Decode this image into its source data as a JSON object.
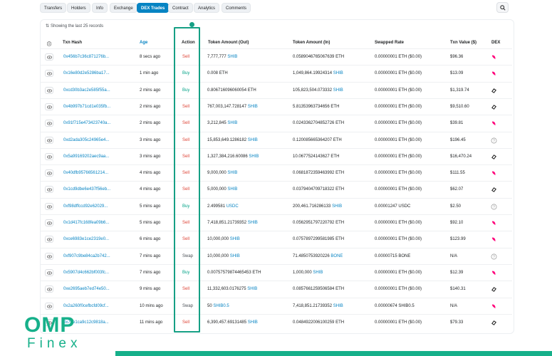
{
  "tabs": [
    {
      "label": "Transfers"
    },
    {
      "label": "Holders"
    },
    {
      "label": "Info"
    },
    {
      "label": "Exchange"
    },
    {
      "label": "DEX Trades",
      "active": true
    },
    {
      "label": "Contract"
    },
    {
      "label": "Analytics"
    },
    {
      "label": "Comments"
    }
  ],
  "search_icon": "search-icon",
  "summary": "Showing the last 25 records",
  "columns": {
    "hash": "Txn Hash",
    "age": "Age",
    "action": "Action",
    "out": "Token Amount (Out)",
    "in": "Token Amount (In)",
    "rate": "Swapped Rate",
    "value": "Txn Value ($)",
    "dex": "DEX"
  },
  "colors": {
    "accent": "#0784c3",
    "sell": "#de4437",
    "buy": "#00a186",
    "brand": "#16b08a"
  },
  "rows": [
    {
      "hash": "0x456b7c36c871276b...",
      "age": "8 secs ago",
      "action": "Sell",
      "out_amt": "7,777,777",
      "out_tok": "SHIB",
      "in_amt": "0.0589046765067639",
      "in_tok": "ETH",
      "rate": "0.00000001 ETH ($0.00)",
      "value": "$96.36",
      "dex": "uniswap-icon"
    },
    {
      "hash": "0x16e80d2e5286ba17...",
      "age": "1 min ago",
      "action": "Buy",
      "out_amt": "0.008",
      "out_tok": "ETH",
      "in_amt": "1,049,864.19924314",
      "in_tok": "SHIB",
      "rate": "0.00000001 ETH ($0.00)",
      "value": "$13.09",
      "dex": "uniswap-icon"
    },
    {
      "hash": "0xcd30b3ac2e585f55a...",
      "age": "2 mins ago",
      "action": "Buy",
      "out_amt": "0.806716096060054",
      "out_tok": "ETH",
      "in_amt": "105,823,504.073332",
      "in_tok": "SHIB",
      "rate": "0.00000001 ETH ($0.00)",
      "value": "$1,319.74",
      "dex": "sushiswap-icon"
    },
    {
      "hash": "0x4b997b71cd1e035fb...",
      "age": "2 mins ago",
      "action": "Sell",
      "out_amt": "767,003,147.728147",
      "out_tok": "SHIB",
      "in_amt": "5.81353963734656",
      "in_tok": "ETH",
      "rate": "0.00000001 ETH ($0.00)",
      "value": "$9,510.60",
      "dex": "sushiswap-icon"
    },
    {
      "hash": "0x91f715e473423740a...",
      "age": "2 mins ago",
      "action": "Sell",
      "out_amt": "3,212,845",
      "out_tok": "SHIB",
      "in_amt": "0.0243362704852726",
      "in_tok": "ETH",
      "rate": "0.00000001 ETH ($0.00)",
      "value": "$39.81",
      "dex": "uniswap-icon"
    },
    {
      "hash": "0xd2ada305c24965e4...",
      "age": "3 mins ago",
      "action": "Sell",
      "out_amt": "15,853,649.1286182",
      "out_tok": "SHIB",
      "in_amt": "0.120085665364207",
      "in_tok": "ETH",
      "rate": "0.00000001 ETH ($0.00)",
      "value": "$196.45",
      "dex": "unknown-dex-icon"
    },
    {
      "hash": "0x5a99169202aec9aa...",
      "age": "3 mins ago",
      "action": "Sell",
      "out_amt": "1,327,384,216.60086",
      "out_tok": "SHIB",
      "in_amt": "10.0677524143627",
      "in_tok": "ETH",
      "rate": "0.00000001 ETH ($0.00)",
      "value": "$16,470.24",
      "dex": "sushiswap-icon"
    },
    {
      "hash": "0x40dfb95766561214...",
      "age": "4 mins ago",
      "action": "Sell",
      "out_amt": "9,000,000",
      "out_tok": "SHIB",
      "in_amt": "0.0681872359463992",
      "in_tok": "ETH",
      "rate": "0.00000001 ETH ($0.00)",
      "value": "$111.55",
      "dex": "uniswap-icon"
    },
    {
      "hash": "0x1cd9dbe6e437f56eb...",
      "age": "4 mins ago",
      "action": "Sell",
      "out_amt": "5,000,000",
      "out_tok": "SHIB",
      "in_amt": "0.0379404709718322",
      "in_tok": "ETH",
      "rate": "0.00000001 ETH ($0.00)",
      "value": "$62.07",
      "dex": "sushiswap-icon"
    },
    {
      "hash": "0xf98dffccd92e62029...",
      "age": "5 mins ago",
      "action": "Buy",
      "out_amt": "2.499581",
      "out_tok": "USDC",
      "in_amt": "200,461.716286133",
      "in_tok": "SHIB",
      "rate": "0.00001247 USDC",
      "value": "$2.50",
      "dex": "unknown-dex-icon"
    },
    {
      "hash": "0x1d417fc168fea09b6...",
      "age": "5 mins ago",
      "action": "Sell",
      "out_amt": "7,418,851.21739352",
      "out_tok": "SHIB",
      "in_amt": "0.0562951797220792",
      "in_tok": "ETH",
      "rate": "0.00000001 ETH ($0.00)",
      "value": "$92.10",
      "dex": "uniswap-icon"
    },
    {
      "hash": "0xce6983e1ce2319e0...",
      "age": "6 mins ago",
      "action": "Sell",
      "out_amt": "10,000,000",
      "out_tok": "SHIB",
      "in_amt": "0.0757897299581985",
      "in_tok": "ETH",
      "rate": "0.00000001 ETH ($0.00)",
      "value": "$123.99",
      "dex": "uniswap-icon"
    },
    {
      "hash": "0xf907c9be84ca2b742...",
      "age": "7 mins ago",
      "action": "Swap",
      "out_amt": "10,000,000",
      "out_tok": "SHIB",
      "in_amt": "71.4850753920226",
      "in_tok": "BONE",
      "rate": "0.00000715 BONE",
      "value": "N/A",
      "dex": "unknown-dex-icon"
    },
    {
      "hash": "0x5907d4c662bf003fc...",
      "age": "7 mins ago",
      "action": "Buy",
      "out_amt": "0.00757579874465453",
      "out_tok": "ETH",
      "in_amt": "1,000,000",
      "in_tok": "SHIB",
      "rate": "0.00000001 ETH ($0.00)",
      "value": "$12.39",
      "dex": "uniswap-icon"
    },
    {
      "hash": "0xe2695aeb7ed74e50...",
      "age": "9 mins ago",
      "action": "Sell",
      "out_amt": "11,332,603.0176275",
      "out_tok": "SHIB",
      "in_amt": "0.0857661259506584",
      "in_tok": "ETH",
      "rate": "0.00000001 ETH ($0.00)",
      "value": "$140.31",
      "dex": "sushiswap-icon"
    },
    {
      "hash": "0x2a260f0cefbcfd09cf...",
      "age": "10 mins ago",
      "action": "Swap",
      "out_amt": "50",
      "out_tok": "SHIB0.5",
      "in_amt": "7,418,851.21739352",
      "in_tok": "SHIB",
      "rate": "0.00000674 SHIB0.5",
      "value": "N/A",
      "dex": "uniswap-icon"
    },
    {
      "hash": "0x70e1ca9c12c9818a...",
      "age": "11 mins ago",
      "action": "Sell",
      "out_amt": "6,390,457.69131485",
      "out_tok": "SHIB",
      "in_amt": "0.0484922006100259",
      "in_tok": "ETH",
      "rate": "0.00000001 ETH ($0.00)",
      "value": "$79.33",
      "dex": "sushiswap-icon"
    }
  ],
  "brand": {
    "top": "OMP",
    "bottom": "Finex"
  }
}
